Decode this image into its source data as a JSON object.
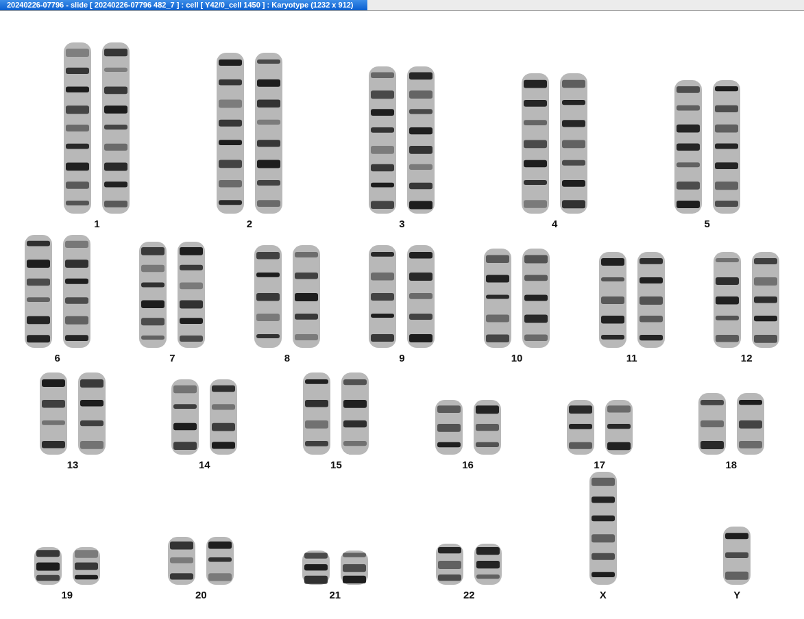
{
  "window": {
    "title": "20240226-07796 - slide [ 20240226-07796 482_7 ] : cell [ Y42/0_cell 1450 ] : Karyotype  (1232 x 912)"
  },
  "karyotype": {
    "rows": [
      {
        "chromosomes": [
          {
            "label": "1",
            "kind": "pair"
          },
          {
            "label": "2",
            "kind": "pair"
          },
          {
            "label": "3",
            "kind": "pair"
          },
          {
            "label": "4",
            "kind": "pair"
          },
          {
            "label": "5",
            "kind": "pair"
          }
        ]
      },
      {
        "chromosomes": [
          {
            "label": "6",
            "kind": "pair"
          },
          {
            "label": "7",
            "kind": "pair"
          },
          {
            "label": "8",
            "kind": "pair"
          },
          {
            "label": "9",
            "kind": "pair"
          },
          {
            "label": "10",
            "kind": "pair"
          },
          {
            "label": "11",
            "kind": "pair"
          },
          {
            "label": "12",
            "kind": "pair"
          }
        ]
      },
      {
        "chromosomes": [
          {
            "label": "13",
            "kind": "pair"
          },
          {
            "label": "14",
            "kind": "pair"
          },
          {
            "label": "15",
            "kind": "pair"
          },
          {
            "label": "16",
            "kind": "pair"
          },
          {
            "label": "17",
            "kind": "pair"
          },
          {
            "label": "18",
            "kind": "pair"
          }
        ]
      },
      {
        "chromosomes": [
          {
            "label": "19",
            "kind": "pair"
          },
          {
            "label": "20",
            "kind": "pair"
          },
          {
            "label": "21",
            "kind": "pair"
          },
          {
            "label": "22",
            "kind": "pair"
          },
          {
            "label": "X",
            "kind": "single"
          },
          {
            "label": "Y",
            "kind": "single"
          }
        ]
      }
    ]
  }
}
